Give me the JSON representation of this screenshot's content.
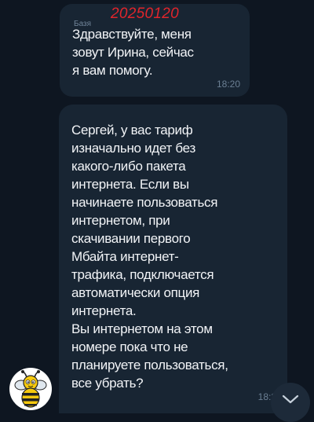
{
  "messages": [
    {
      "sender": "Базя",
      "stamp": "20250120",
      "text": "Здравствуйте, меня\nзовут Ирина, сейчас\nя вам помогу.",
      "time": "18:20"
    },
    {
      "text": "Сергей, у вас тариф\nизначально идет без\nкакого-либо пакета\nинтернета. Если вы\nначинаете пользоваться\nинтернетом, при\nскачивании первого\nМбайта интернет-\nтрафика, подключается\nавтоматически опция\nинтернета.\nВы интернетом на этом\nномере пока что не\nпланируете пользоваться,\nвсе убрать?",
      "time": "18:2"
    }
  ],
  "avatar": {
    "icon": "bee-icon"
  },
  "scroll_button": {
    "icon": "chevron-down-icon"
  },
  "colors": {
    "background": "#0e1621",
    "bubble": "#182533",
    "text": "#f2f4f7",
    "meta": "#708499",
    "stamp": "#e0252b"
  }
}
